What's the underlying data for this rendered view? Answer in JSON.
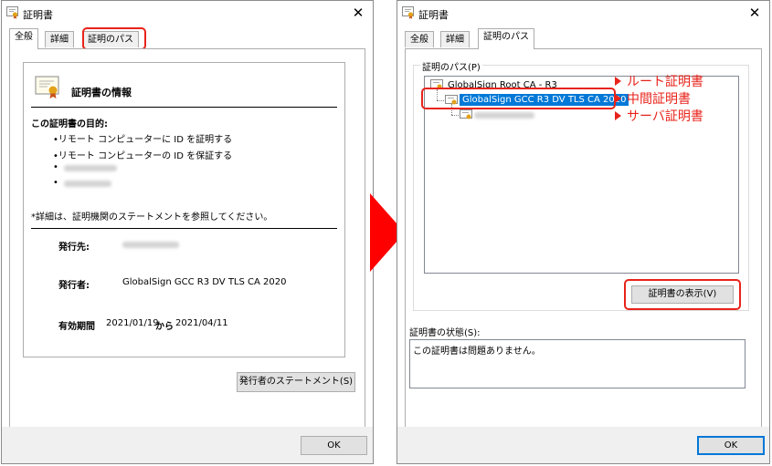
{
  "left_dialog": {
    "title": "証明書",
    "close_glyph": "✕",
    "tabs": [
      {
        "label": "全般"
      },
      {
        "label": "詳細"
      },
      {
        "label": "証明のパス"
      }
    ],
    "info_heading": "証明書の情報",
    "purpose_heading": "この証明書の目的:",
    "purposes": [
      "•リモート コンピューターに ID を証明する",
      "•リモート コンピューターの ID を保証する"
    ],
    "bullet": "•",
    "note": "*詳細は、証明機関のステートメントを参照してください。",
    "issued_to_label": "発行先:",
    "issued_by_label": "発行者:",
    "issued_by_value": "GlobalSign GCC R3 DV TLS CA 2020",
    "validity_label": "有効期間",
    "valid_from": "2021/01/19",
    "validity_to_word": "から",
    "valid_to": "2021/04/11",
    "issuer_statement_button": "発行者のステートメント(S)",
    "ok_button": "OK"
  },
  "right_dialog": {
    "title": "証明書",
    "close_glyph": "✕",
    "tabs": [
      {
        "label": "全般"
      },
      {
        "label": "詳細"
      },
      {
        "label": "証明のパス"
      }
    ],
    "path_group_label": "証明のパス(P)",
    "tree": {
      "root": "GlobalSign Root CA - R3",
      "intermediate": "GlobalSign GCC R3 DV TLS CA 2020"
    },
    "view_cert_button": "証明書の表示(V)",
    "status_label": "証明書の状態(S):",
    "status_text": "この証明書は問題ありません。",
    "ok_button": "OK"
  },
  "annotations": {
    "root": "ルート証明書",
    "intermediate": "中間証明書",
    "server": "サーバ証明書",
    "color": "#e8231a"
  },
  "colors": {
    "selection": "#0078d7",
    "highlight_box": "#e8231a",
    "arrow": "#ff0000"
  }
}
